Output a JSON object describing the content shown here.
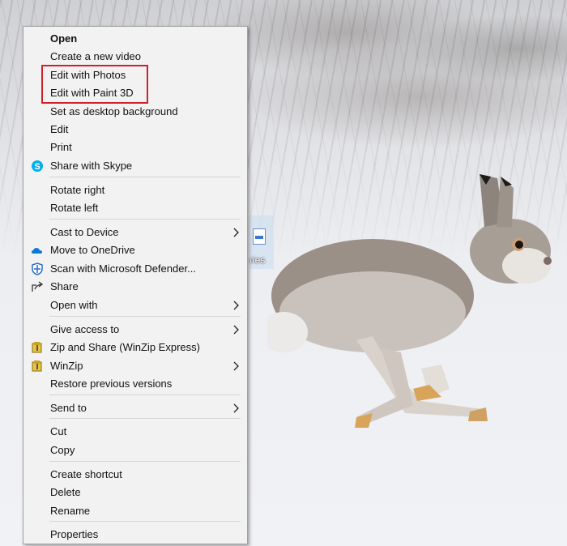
{
  "desktop": {
    "icon_label": "ries"
  },
  "menu": {
    "items": [
      {
        "label": "Open",
        "bold": true,
        "icon": "",
        "arrow": false
      },
      {
        "label": "Create a new video",
        "icon": "",
        "arrow": false
      },
      {
        "label": "Edit with Photos",
        "icon": "",
        "arrow": false
      },
      {
        "label": "Edit with Paint 3D",
        "icon": "",
        "arrow": false
      },
      {
        "label": "Set as desktop background",
        "icon": "",
        "arrow": false
      },
      {
        "label": "Edit",
        "icon": "",
        "arrow": false
      },
      {
        "label": "Print",
        "icon": "",
        "arrow": false
      },
      {
        "label": "Share with Skype",
        "icon": "skype-icon",
        "arrow": false
      },
      {
        "label": "Rotate right",
        "icon": "",
        "arrow": false
      },
      {
        "label": "Rotate left",
        "icon": "",
        "arrow": false
      },
      {
        "label": "Cast to Device",
        "icon": "",
        "arrow": true
      },
      {
        "label": "Move to OneDrive",
        "icon": "onedrive-icon",
        "arrow": false
      },
      {
        "label": "Scan with Microsoft Defender...",
        "icon": "defender-shield-icon",
        "arrow": false
      },
      {
        "label": "Share",
        "icon": "share-icon",
        "arrow": false
      },
      {
        "label": "Open with",
        "icon": "",
        "arrow": true
      },
      {
        "label": "Give access to",
        "icon": "",
        "arrow": true
      },
      {
        "label": "Zip and Share (WinZip Express)",
        "icon": "winzip-icon",
        "arrow": false
      },
      {
        "label": "WinZip",
        "icon": "winzip-icon",
        "arrow": true
      },
      {
        "label": "Restore previous versions",
        "icon": "",
        "arrow": false
      },
      {
        "label": "Send to",
        "icon": "",
        "arrow": true
      },
      {
        "label": "Cut",
        "icon": "",
        "arrow": false
      },
      {
        "label": "Copy",
        "icon": "",
        "arrow": false
      },
      {
        "label": "Create shortcut",
        "icon": "",
        "arrow": false
      },
      {
        "label": "Delete",
        "icon": "",
        "arrow": false
      },
      {
        "label": "Rename",
        "icon": "",
        "arrow": false
      },
      {
        "label": "Properties",
        "icon": "",
        "arrow": false
      }
    ],
    "highlighted_items": [
      "Edit with Photos",
      "Edit with Paint 3D"
    ],
    "highlight_color": "#d0202a"
  },
  "colors": {
    "menu_background": "#f2f2f2",
    "skype": "#00aff0",
    "onedrive": "#0f78d4",
    "defender": "#2a6cc4"
  }
}
